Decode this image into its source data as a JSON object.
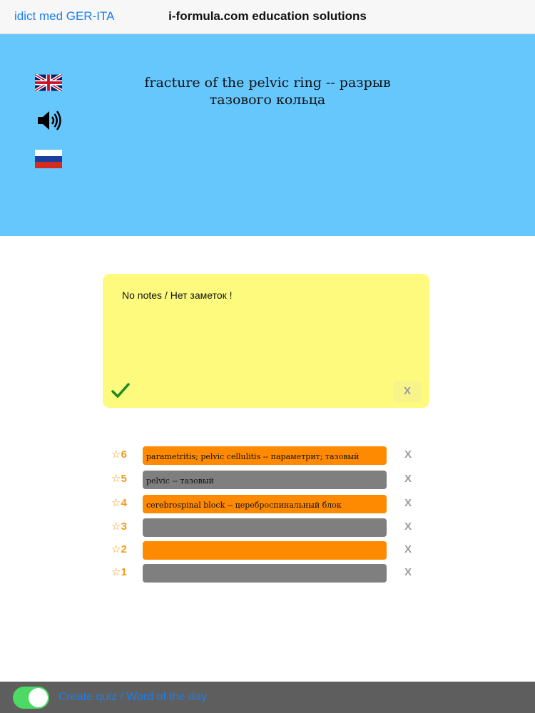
{
  "topbar": {
    "back_label": "idict med GER-ITA",
    "title": "i-formula.com education solutions"
  },
  "hero": {
    "term": "fracture of the pelvic ring -- разрыв тазового кольца",
    "icons": [
      "uk-flag-icon",
      "speaker-icon",
      "russia-flag-icon"
    ]
  },
  "notes": {
    "text": "No notes / Нет заметок !",
    "save_icon": "checkmark-icon",
    "clear_label": "X"
  },
  "history": [
    {
      "rank": "☆6",
      "text": "parametritis; pelvic cellulitis -- параметрит; тазовый",
      "color": "#fe8a02",
      "remove_label": "X"
    },
    {
      "rank": "☆5",
      "text": "pelvic -- тазовый",
      "color": "#7f7f7f",
      "remove_label": "X"
    },
    {
      "rank": "☆4",
      "text": "cerebrospinal block -- цереброспинальный блок",
      "color": "#fe8a02",
      "remove_label": "X"
    },
    {
      "rank": "☆3",
      "text": "",
      "color": "#7f7f7f",
      "remove_label": "X"
    },
    {
      "rank": "☆2",
      "text": "",
      "color": "#fe8a02",
      "remove_label": "X"
    },
    {
      "rank": "☆1",
      "text": "",
      "color": "#7f7f7f",
      "remove_label": "X"
    }
  ],
  "bottombar": {
    "toggle_on": true,
    "label": "Create quiz / Word of the day"
  },
  "colors": {
    "hero_bg": "#66c7fd",
    "notes_bg": "#fdfa7d",
    "accent_blue": "#1a7ff0",
    "toggle_green": "#4cd964"
  }
}
